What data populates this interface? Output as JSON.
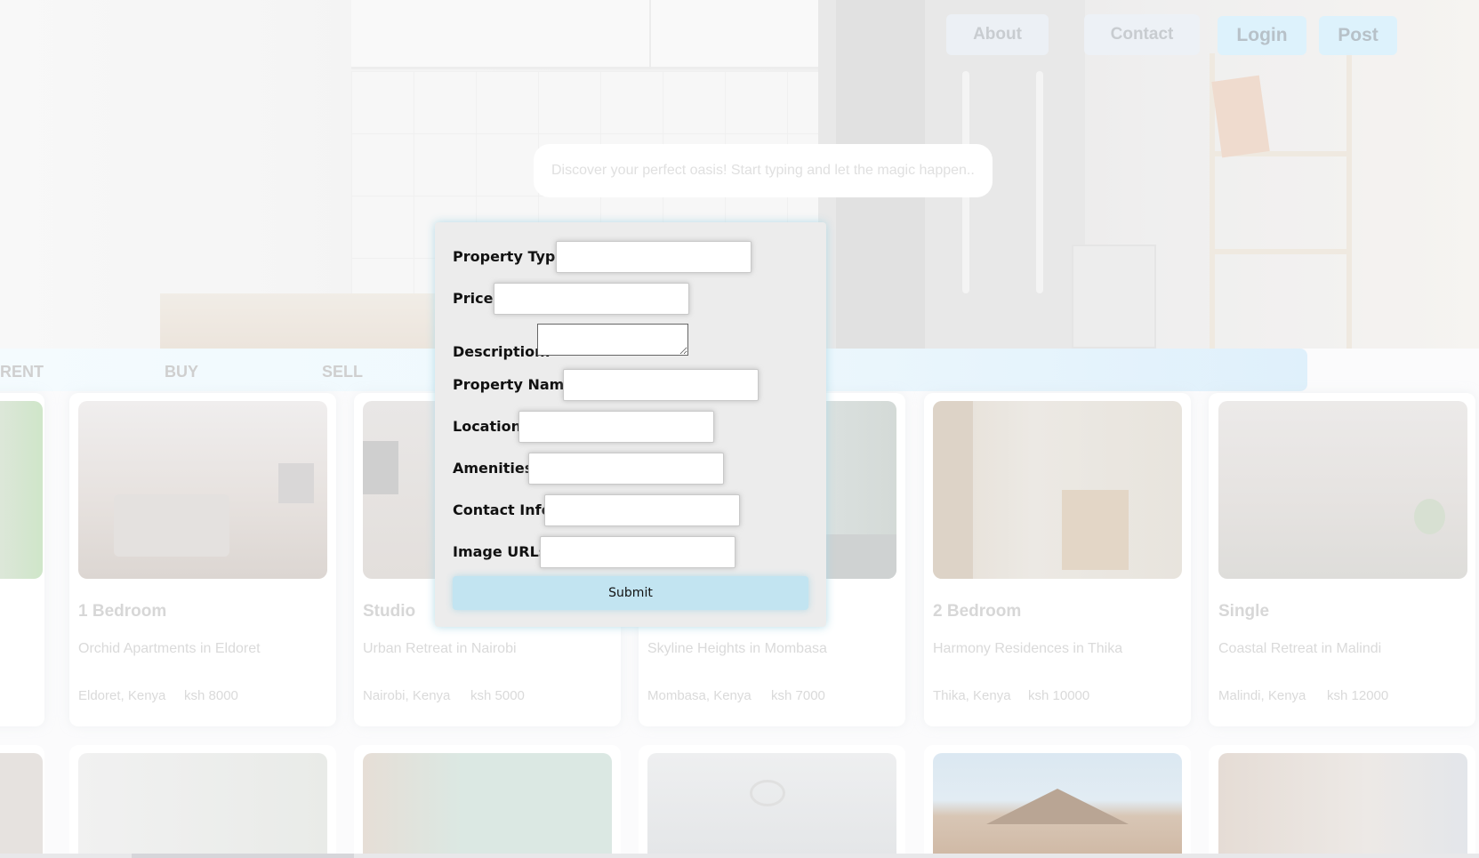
{
  "nav": {
    "about": "About",
    "contact": "Contact",
    "login": "Login",
    "post": "Post"
  },
  "search": {
    "placeholder": "Discover your perfect oasis! Start typing and let the magic happen..."
  },
  "tabs": [
    "RENT",
    "BUY",
    "SELL"
  ],
  "listings": [
    {
      "title": "1 Bedroom",
      "desc": "Orchid Apartments in Eldoret",
      "location": "Eldoret, Kenya",
      "price": "ksh 8000"
    },
    {
      "title": "Studio",
      "desc": "Urban Retreat in Nairobi",
      "location": "Nairobi, Kenya",
      "price": "ksh 5000"
    },
    {
      "title": "",
      "desc": "Skyline Heights in Mombasa",
      "location": "Mombasa, Kenya",
      "price": "ksh 7000"
    },
    {
      "title": "2 Bedroom",
      "desc": "Harmony Residences in Thika",
      "location": "Thika, Kenya",
      "price": "ksh 10000"
    },
    {
      "title": "Single",
      "desc": "Coastal Retreat in Malindi",
      "location": "Malindi, Kenya",
      "price": "ksh 12000"
    }
  ],
  "form": {
    "property_type": "Property Type:",
    "price": "Price:",
    "description": "Description:",
    "property_name": "Property Name:",
    "location": "Location:",
    "amenities": "Amenities:",
    "contact_info": "Contact Info:",
    "image_urls": "Image URLs:",
    "submit": "Submit"
  },
  "colors": {
    "accent": "#c2e4f1",
    "modal_glow": "#add8e6"
  }
}
